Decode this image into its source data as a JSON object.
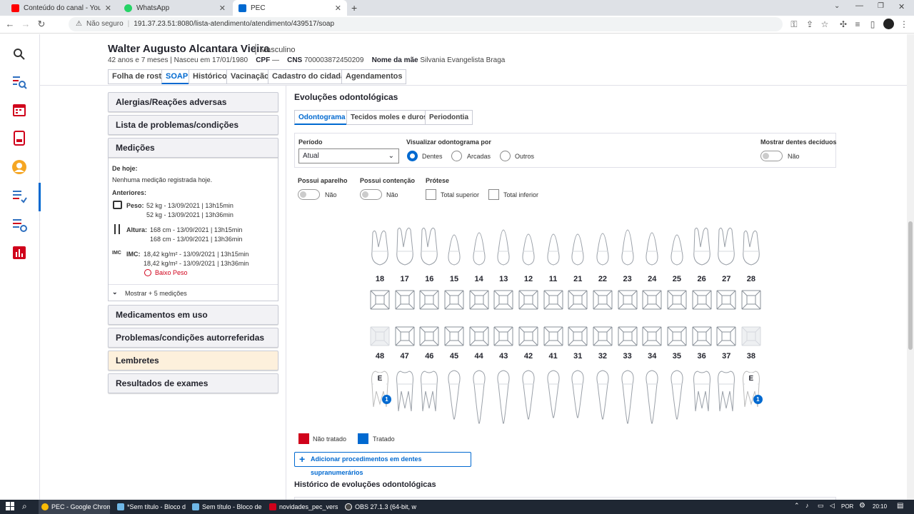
{
  "browser": {
    "tabs": [
      {
        "label": "Conteúdo do canal - YouTube St",
        "color": "#ff0000"
      },
      {
        "label": "WhatsApp",
        "color": "#25d366"
      },
      {
        "label": "PEC",
        "color": "#0069d0"
      }
    ],
    "security": "Não seguro",
    "url": "191.37.23.51:8080/lista-atendimento/atendimento/439517/soap"
  },
  "patient": {
    "name": "Walter Augusto Alcantara Vieira",
    "sex": "Masculino",
    "age": "42 anos e 7 meses | Nasceu em 17/01/1980",
    "cpf_label": "CPF",
    "cpf_value": "—",
    "cns_label": "CNS",
    "cns_value": "700003872450209",
    "mother_label": "Nome da mãe",
    "mother_value": "Silvania Evangelista Braga"
  },
  "nav_tabs": [
    "Folha de rosto",
    "SOAP",
    "Histórico",
    "Vacinação",
    "Cadastro do cidadão",
    "Agendamentos"
  ],
  "left_panel": {
    "alergias": "Alergias/Reações adversas",
    "problemas": "Lista de problemas/condições",
    "medicoes": "Medições",
    "de_hoje": "De hoje:",
    "nenhuma": "Nenhuma medição registrada hoje.",
    "anteriores": "Anteriores:",
    "peso_label": "Peso:",
    "peso_1": "52 kg - 13/09/2021 | 13h15min",
    "peso_2": "52 kg - 13/09/2021 | 13h36min",
    "altura_label": "Altura:",
    "altura_1": "168 cm - 13/09/2021 | 13h15min",
    "altura_2": "168 cm - 13/09/2021 | 13h36min",
    "imc_icon": "IMC",
    "imc_label": "IMC:",
    "imc_1": "18,42 kg/m² - 13/09/2021 | 13h15min",
    "imc_2": "18,42 kg/m² - 13/09/2021 | 13h36min",
    "baixo_peso": "Baixo Peso",
    "mostrar": "Mostrar + 5 medições",
    "medicamentos": "Medicamentos em uso",
    "autorreferidas": "Problemas/condições autorreferidas",
    "lembretes": "Lembretes",
    "exames": "Resultados de exames"
  },
  "evolucoes": {
    "title": "Evoluções odontológicas",
    "tabs": [
      "Odontograma",
      "Tecidos moles e duros",
      "Periodontia"
    ],
    "periodo_label": "Período",
    "periodo_value": "Atual",
    "visualizar_label": "Visualizar odontograma por",
    "view_options": [
      "Dentes",
      "Arcadas",
      "Outros"
    ],
    "deciduos_label": "Mostrar dentes decíduos",
    "deciduos_value": "Não",
    "aparelho_label": "Possui aparelho",
    "aparelho_value": "Não",
    "contencao_label": "Possui contenção",
    "contencao_value": "Não",
    "protese_label": "Prótese",
    "protese_sup": "Total superior",
    "protese_inf": "Total inferior",
    "upper_teeth": [
      "18",
      "17",
      "16",
      "15",
      "14",
      "13",
      "12",
      "11",
      "21",
      "22",
      "23",
      "24",
      "25",
      "26",
      "27",
      "28"
    ],
    "lower_teeth": [
      "48",
      "47",
      "46",
      "45",
      "44",
      "43",
      "42",
      "41",
      "31",
      "32",
      "33",
      "34",
      "35",
      "36",
      "37",
      "38"
    ],
    "marker_letter": "E",
    "marker_badge": "1",
    "legend_nao_tratado": "Não tratado",
    "legend_tratado": "Tratado",
    "color_nao_tratado": "#d0021b",
    "color_tratado": "#0069d0",
    "add_button": "Adicionar procedimentos em dentes supranumerários",
    "historico_title": "Histórico de evoluções odontológicas"
  },
  "taskbar": {
    "items": [
      "PEC - Google Chrome",
      "*Sem título - Bloco d...",
      "Sem título - Bloco de ...",
      "novidades_pec_versa...",
      "OBS 27.1.3 (64-bit, wi..."
    ],
    "lang": "POR",
    "time": "20:10"
  }
}
